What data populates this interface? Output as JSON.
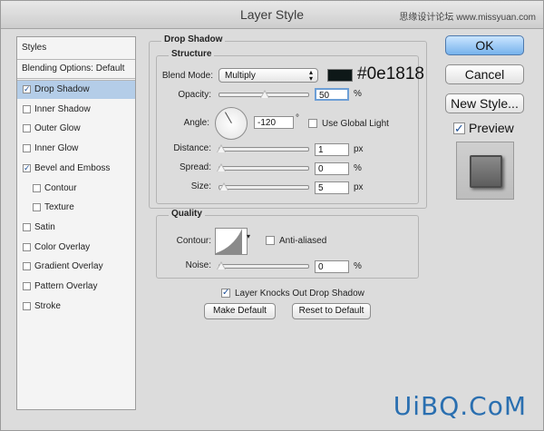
{
  "window": {
    "title": "Layer Style"
  },
  "watermark": {
    "top": "思缘设计论坛 www.missyuan.com",
    "bottom": "UiBQ.CoM"
  },
  "styles_panel": {
    "header": "Styles",
    "blending": "Blending Options: Default",
    "items": [
      {
        "label": "Drop Shadow",
        "checked": true,
        "selected": true
      },
      {
        "label": "Inner Shadow",
        "checked": false
      },
      {
        "label": "Outer Glow",
        "checked": false
      },
      {
        "label": "Inner Glow",
        "checked": false
      },
      {
        "label": "Bevel and Emboss",
        "checked": true
      },
      {
        "label": "Contour",
        "checked": false,
        "sub": true
      },
      {
        "label": "Texture",
        "checked": false,
        "sub": true
      },
      {
        "label": "Satin",
        "checked": false
      },
      {
        "label": "Color Overlay",
        "checked": false
      },
      {
        "label": "Gradient Overlay",
        "checked": false
      },
      {
        "label": "Pattern Overlay",
        "checked": false
      },
      {
        "label": "Stroke",
        "checked": false
      }
    ]
  },
  "drop_shadow": {
    "group_title": "Drop Shadow",
    "structure_title": "Structure",
    "blend_mode_label": "Blend Mode:",
    "blend_mode_value": "Multiply",
    "color_hex": "#0e1818",
    "opacity_label": "Opacity:",
    "opacity_value": "50",
    "opacity_unit": "%",
    "angle_label": "Angle:",
    "angle_value": "-120",
    "angle_unit": "°",
    "global_light_label": "Use Global Light",
    "distance_label": "Distance:",
    "distance_value": "1",
    "distance_unit": "px",
    "spread_label": "Spread:",
    "spread_value": "0",
    "spread_unit": "%",
    "size_label": "Size:",
    "size_value": "5",
    "size_unit": "px",
    "quality_title": "Quality",
    "contour_label": "Contour:",
    "antialiased_label": "Anti-aliased",
    "noise_label": "Noise:",
    "noise_value": "0",
    "noise_unit": "%",
    "knockout_label": "Layer Knocks Out Drop Shadow",
    "make_default": "Make Default",
    "reset_default": "Reset to Default"
  },
  "buttons": {
    "ok": "OK",
    "cancel": "Cancel",
    "new_style": "New Style...",
    "preview": "Preview"
  },
  "colors": {
    "ok_accent": "#76b2ec",
    "selection": "#b4cde8"
  }
}
